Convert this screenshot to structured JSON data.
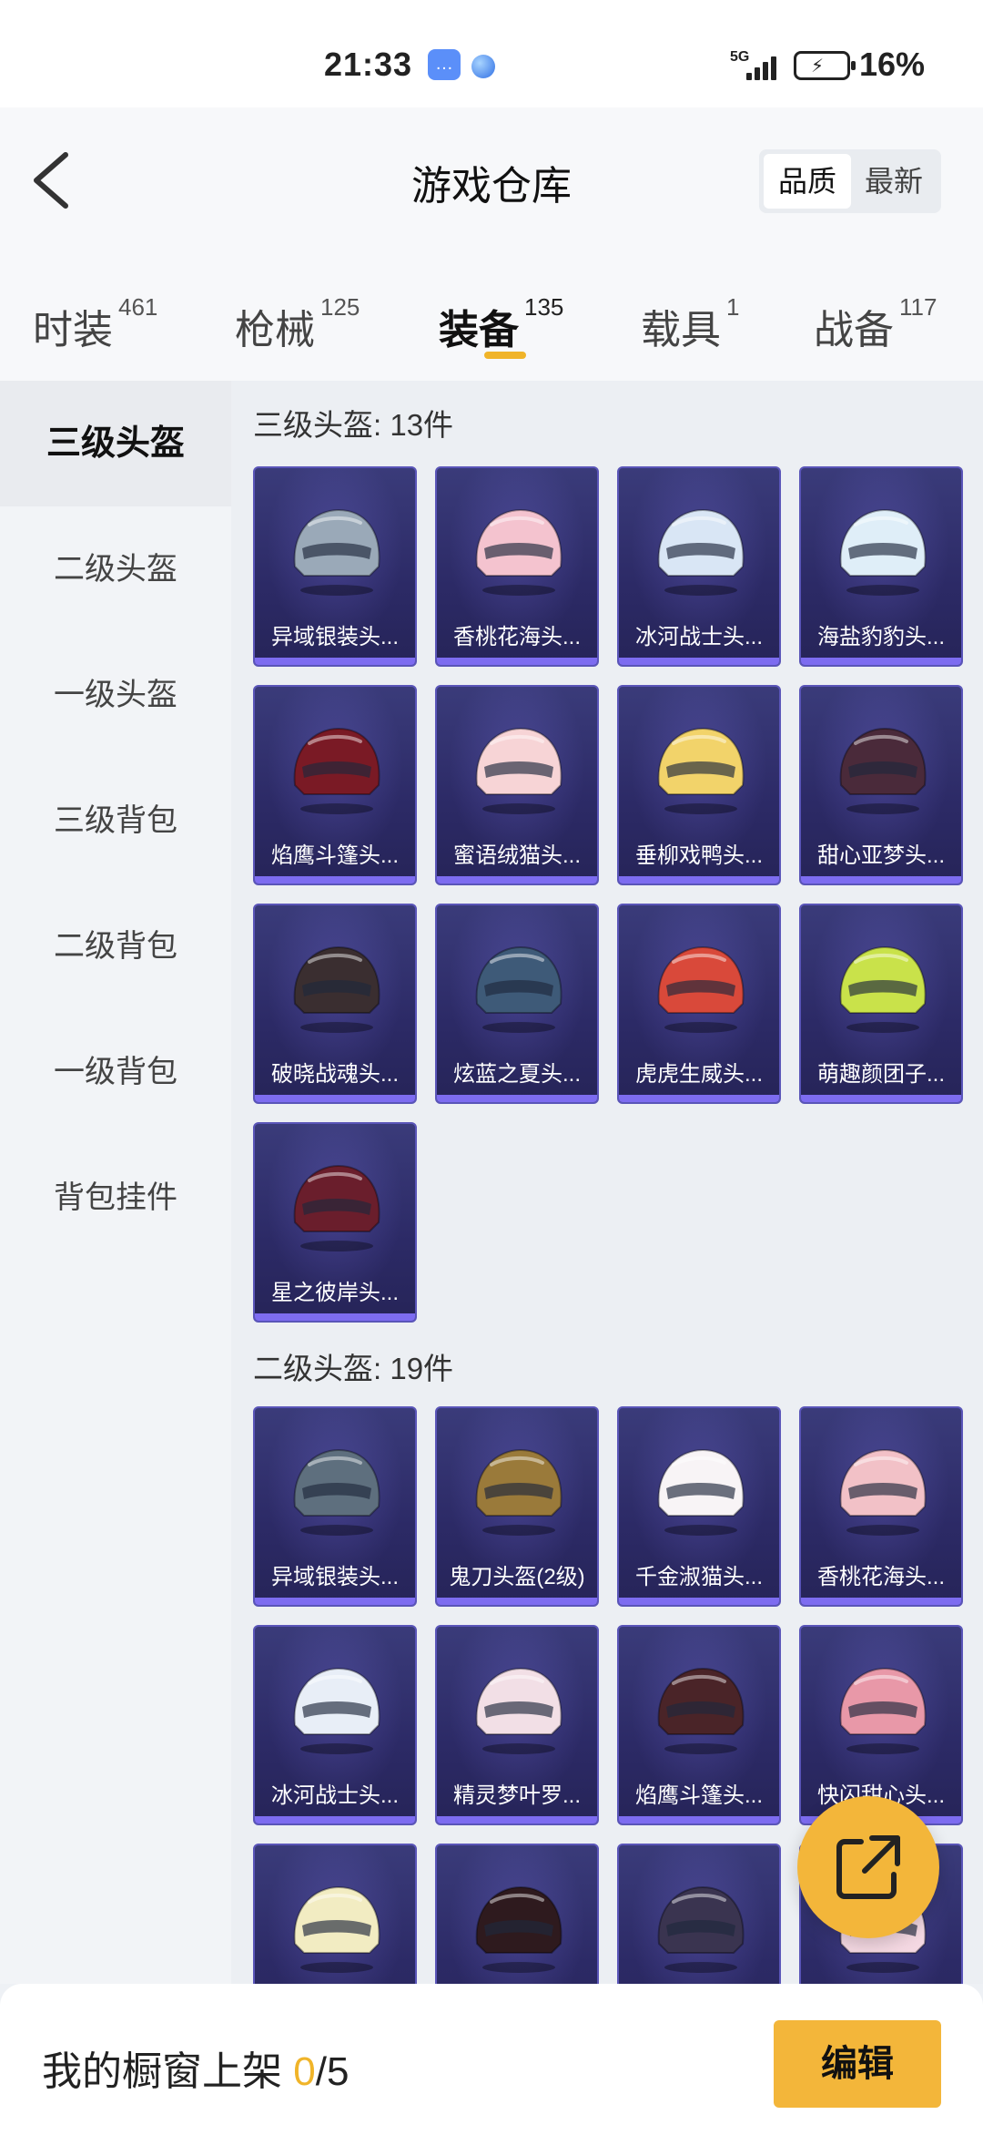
{
  "status_bar": {
    "time": "21:33",
    "network": "5G",
    "battery": "16%"
  },
  "header": {
    "title": "游戏仓库",
    "sort": {
      "quality": "品质",
      "latest": "最新"
    }
  },
  "tabs": [
    {
      "label": "时装",
      "count": "461"
    },
    {
      "label": "枪械",
      "count": "125"
    },
    {
      "label": "装备",
      "count": "135"
    },
    {
      "label": "载具",
      "count": "1"
    },
    {
      "label": "战备",
      "count": "117"
    }
  ],
  "sidebar": {
    "items": [
      {
        "label": "三级头盔"
      },
      {
        "label": "二级头盔"
      },
      {
        "label": "一级头盔"
      },
      {
        "label": "三级背包"
      },
      {
        "label": "二级背包"
      },
      {
        "label": "一级背包"
      },
      {
        "label": "背包挂件"
      }
    ]
  },
  "sections": [
    {
      "title": "三级头盔: 13件",
      "items": [
        {
          "name": "异域银装头...",
          "color": "#9aa9b8"
        },
        {
          "name": "香桃花海头...",
          "color": "#f4c3cf"
        },
        {
          "name": "冰河战士头...",
          "color": "#d9e6f5"
        },
        {
          "name": "海盐豹豹头...",
          "color": "#dfeef8"
        },
        {
          "name": "焰鹰斗篷头...",
          "color": "#7a1a25"
        },
        {
          "name": "蜜语绒猫头...",
          "color": "#f7d4d6"
        },
        {
          "name": "垂柳戏鸭头...",
          "color": "#f2d36a"
        },
        {
          "name": "甜心亚梦头...",
          "color": "#4a2a3a"
        },
        {
          "name": "破晓战魂头...",
          "color": "#3a2e30"
        },
        {
          "name": "炫蓝之夏头...",
          "color": "#3e5a78"
        },
        {
          "name": "虎虎生威头...",
          "color": "#d9493a"
        },
        {
          "name": "萌趣颜团子...",
          "color": "#c9e24a"
        },
        {
          "name": "星之彼岸头...",
          "color": "#6a1e2c"
        }
      ]
    },
    {
      "title": "二级头盔: 19件",
      "items": [
        {
          "name": "异域银装头...",
          "color": "#5e6f7e"
        },
        {
          "name": "鬼刀头盔(2级)",
          "color": "#9a7a3a"
        },
        {
          "name": "千金淑猫头...",
          "color": "#f8f4f6"
        },
        {
          "name": "香桃花海头...",
          "color": "#f2c1c7"
        },
        {
          "name": "冰河战士头...",
          "color": "#e8eef7"
        },
        {
          "name": "精灵梦叶罗...",
          "color": "#f2dfe6"
        },
        {
          "name": "焰鹰斗篷头...",
          "color": "#4a2428"
        },
        {
          "name": "快闪甜心头...",
          "color": "#e898a8"
        },
        {
          "name": "",
          "color": "#f2ecc2"
        },
        {
          "name": "",
          "color": "#2e1a1e"
        },
        {
          "name": "",
          "color": "#3a3450"
        },
        {
          "name": "",
          "color": "#f4d8e2"
        }
      ]
    }
  ],
  "bottom_bar": {
    "label": "我的橱窗上架",
    "count": "0",
    "total": "/5",
    "edit": "编辑"
  }
}
